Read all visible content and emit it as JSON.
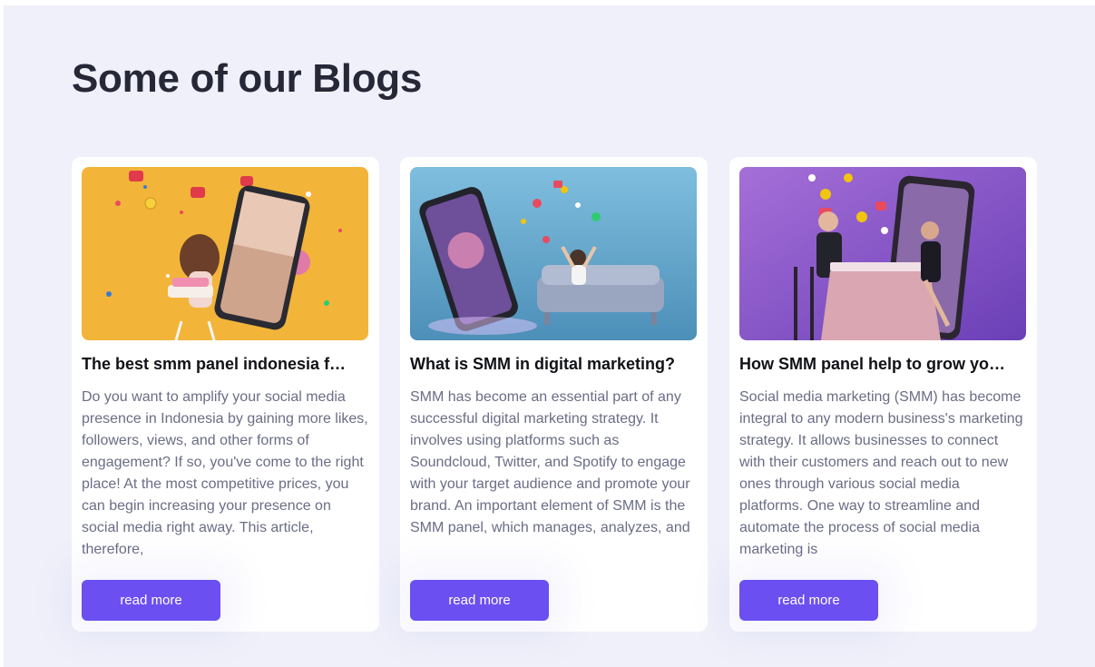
{
  "section": {
    "heading": "Some of our Blogs"
  },
  "colors": {
    "accent": "#6c4ff0",
    "background": "#eff0f9",
    "card": "#ffffff",
    "text_muted": "#6a6d86"
  },
  "blogs": [
    {
      "title": "The best smm panel indonesia f…",
      "excerpt": "Do you want to amplify your social media presence in Indonesia by gaining more likes, followers, views, and other forms of engagement? If so, you've come to the right place! At the most competitive prices, you can begin increasing your presence on social media right away. This article, therefore,",
      "button_label": "read more",
      "image": "woman-birthday-cake-smartphone-photo"
    },
    {
      "title": "What is SMM in digital marketing?",
      "excerpt": "SMM has become an essential part of any successful digital marketing strategy. It involves using platforms such as Soundcloud, Twitter, and Spotify to engage with your target audience and promote your brand. An important element of SMM is the SMM panel, which manages, analyzes, and",
      "button_label": "read more",
      "image": "party-smartphone-couch-photo"
    },
    {
      "title": "How SMM panel help to grow yo…",
      "excerpt": "Social media marketing (SMM) has become integral to any modern business's marketing strategy. It allows businesses to connect with their customers and reach out to new ones through various social media platforms. One way to streamline and automate the process of social media marketing is",
      "button_label": "read more",
      "image": "dinner-date-smartphone-photo"
    }
  ]
}
